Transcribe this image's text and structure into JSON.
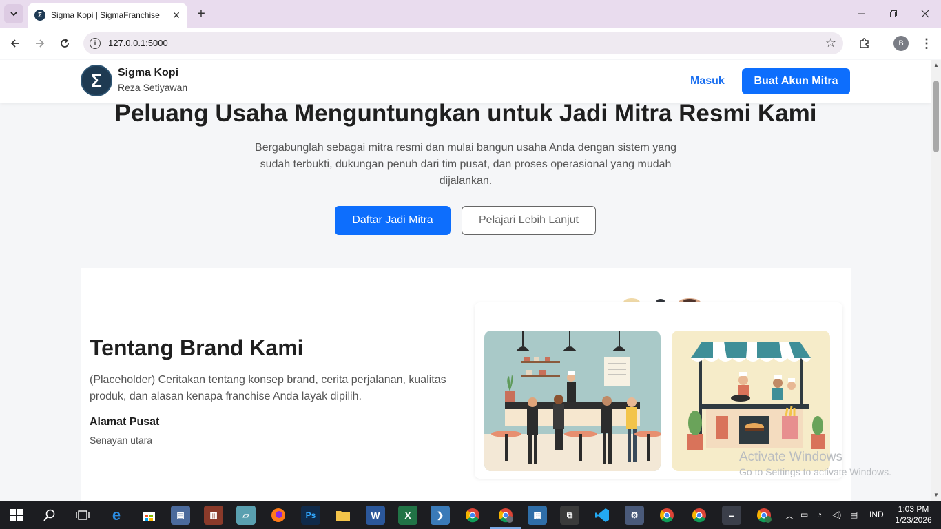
{
  "browser": {
    "tab_title": "Sigma Kopi | SigmaFranchise",
    "url": "127.0.0.1:5000",
    "profile_initial": "B"
  },
  "header": {
    "brand_name": "Sigma Kopi",
    "brand_owner": "Reza Setiyawan",
    "login_label": "Masuk",
    "signup_label": "Buat Akun Mitra"
  },
  "hero": {
    "title": "Peluang Usaha Menguntungkan untuk Jadi Mitra Resmi Kami",
    "description": "Bergabunglah sebagai mitra resmi dan mulai bangun usaha Anda dengan sistem yang sudah terbukti, dukungan penuh dari tim pusat, dan proses operasional yang mudah dijalankan.",
    "primary_button": "Daftar Jadi Mitra",
    "secondary_button": "Pelajari Lebih Lanjut"
  },
  "about": {
    "title": "Tentang Brand Kami",
    "description": "(Placeholder) Ceritakan tentang konsep brand, cerita perjalanan, kualitas produk, dan alasan kenapa franchise Anda layak dipilih.",
    "address_title": "Alamat Pusat",
    "address_value": "Senayan utara"
  },
  "watermark": {
    "line1": "Activate Windows",
    "line2": "Go to Settings to activate Windows."
  },
  "taskbar": {
    "language": "IND",
    "time": "1:03 PM",
    "date": "1/23/2026"
  }
}
